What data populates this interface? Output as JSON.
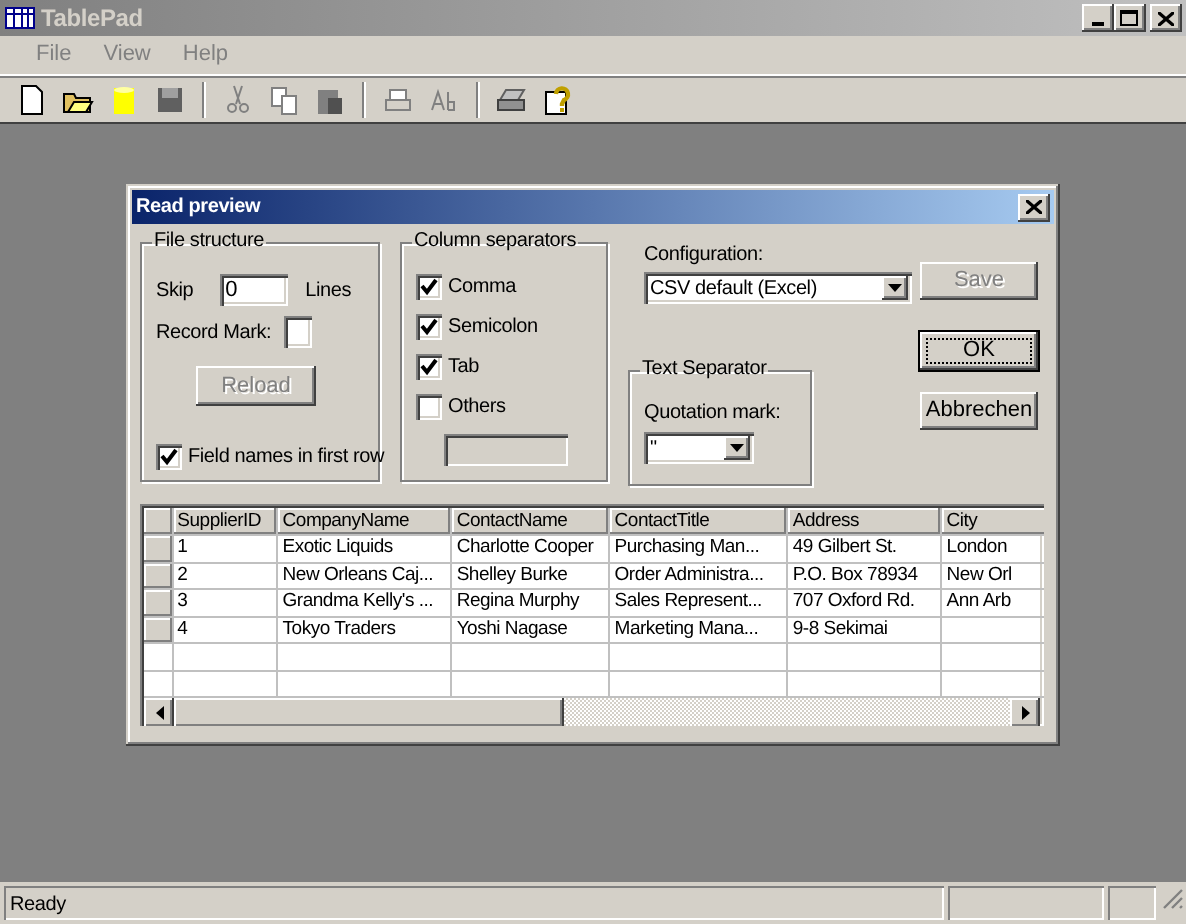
{
  "window": {
    "title": "TablePad"
  },
  "menu": [
    "File",
    "View",
    "Help"
  ],
  "dialog": {
    "title": "Read preview",
    "file_structure": {
      "title": "File structure",
      "skip_label": "Skip",
      "skip_value": "0",
      "lines_label": "Lines",
      "record_mark_label": "Record Mark:",
      "reload": {
        "label": "Reload",
        "disabled": true
      },
      "field_names": {
        "label": "Field names in first row",
        "checked": true
      }
    },
    "column_separators": {
      "title": "Column separators",
      "options": [
        {
          "label": "Comma",
          "checked": true
        },
        {
          "label": "Semicolon",
          "checked": true
        },
        {
          "label": "Tab",
          "checked": true
        },
        {
          "label": "Others",
          "checked": false
        }
      ],
      "others_field": {
        "disabled": true
      }
    },
    "configuration": {
      "label": "Configuration:",
      "value": "CSV default (Excel)"
    },
    "text_separator": {
      "title": "Text Separator",
      "label": "Quotation mark:",
      "value": "\""
    },
    "buttons": [
      {
        "label": "Save",
        "disabled": true,
        "default": false
      },
      {
        "label": "OK",
        "disabled": false,
        "default": true
      },
      {
        "label": "Abbrechen",
        "disabled": false,
        "default": false
      }
    ],
    "table": {
      "columns": [
        "SupplierID",
        "CompanyName",
        "ContactName",
        "ContactTitle",
        "Address",
        "City"
      ],
      "rows": [
        [
          "1",
          "Exotic Liquids",
          "Charlotte Cooper",
          "Purchasing Man...",
          "49 Gilbert St.",
          "London"
        ],
        [
          "2",
          "New Orleans Caj...",
          "Shelley Burke",
          "Order Administra...",
          "P.O. Box 78934",
          "New Orl"
        ],
        [
          "3",
          "Grandma Kelly's ...",
          "Regina Murphy",
          "Sales Represent...",
          "707 Oxford Rd.",
          "Ann Arb"
        ],
        [
          "4",
          "Tokyo Traders",
          "Yoshi Nagase",
          "Marketing Mana...",
          "9-8 Sekimai",
          ""
        ]
      ]
    }
  },
  "status_bar": {
    "text": "Ready"
  }
}
